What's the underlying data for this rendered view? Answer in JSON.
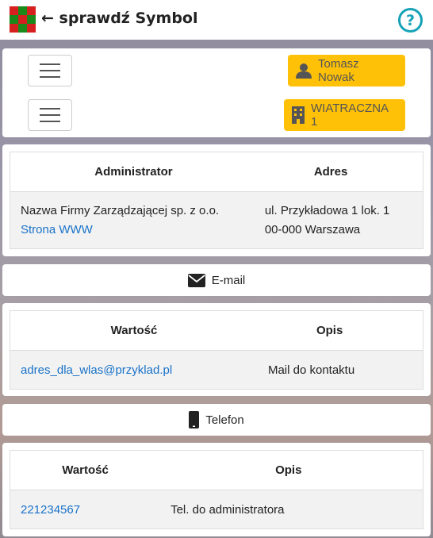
{
  "header": {
    "title": "← sprawdź Symbol",
    "help_symbol": "?"
  },
  "nav": {
    "user_label": "Tomasz Nowak",
    "building_label": "WIATRACZNA 1"
  },
  "admin_table": {
    "headers": [
      "Administrator",
      "Adres"
    ],
    "admin_name": "Nazwa Firmy Zarządzającej sp. z o.o.",
    "admin_link": "Strona WWW",
    "address_line1": "ul. Przykładowa 1 lok. 1",
    "address_line2": "00-000 Warszawa"
  },
  "email_section": {
    "label": "E-mail",
    "headers": [
      "Wartość",
      "Opis"
    ],
    "value": "adres_dla_wlas@przyklad.pl",
    "description": "Mail do kontaktu"
  },
  "phone_section": {
    "label": "Telefon",
    "headers": [
      "Wartość",
      "Opis"
    ],
    "value": "221234567",
    "description": "Tel. do administratora"
  },
  "colors": {
    "accent_warning": "#ffc107",
    "info": "#17a2b8",
    "link": "#1a73c9"
  }
}
